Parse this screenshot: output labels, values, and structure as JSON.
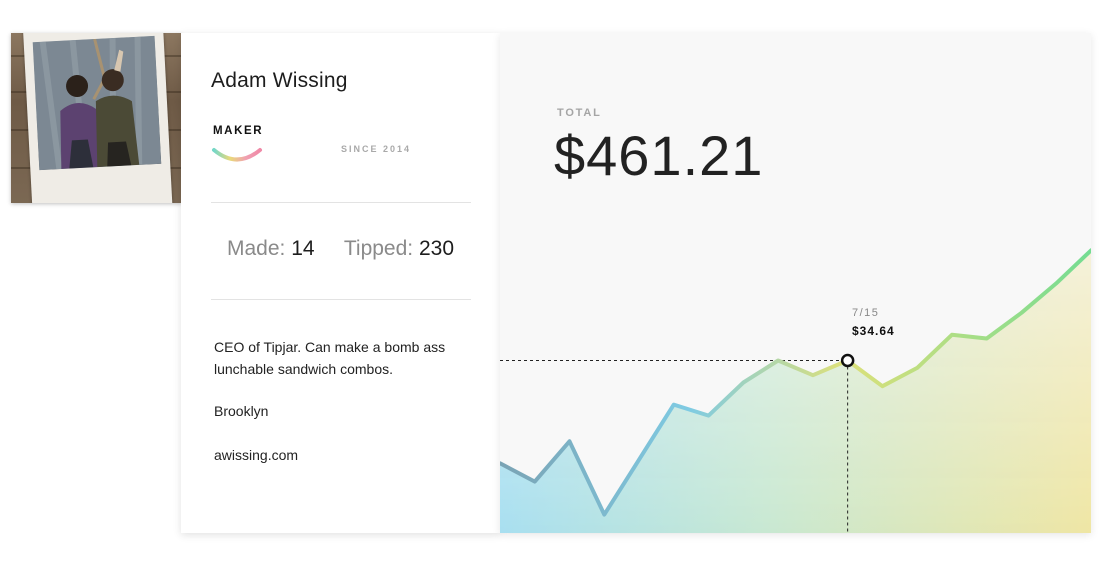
{
  "profile": {
    "name": "Adam Wissing",
    "badge": "MAKER",
    "since": "SINCE 2014",
    "stats": {
      "made_label": "Made:",
      "made_value": "14",
      "tipped_label": "Tipped:",
      "tipped_value": "230"
    },
    "bio": "CEO of Tipjar. Can make a bomb ass lunchable sandwich combos.",
    "location": "Brooklyn",
    "website": "awissing.com"
  },
  "summary": {
    "total_label": "TOTAL",
    "total_value": "$461.21"
  },
  "tooltip": {
    "date": "7/15",
    "value": "$34.64"
  },
  "colors": {
    "line_start": "#7aa3b4",
    "line_mid": "#7fcbe3",
    "line_peak": "#dde07a",
    "line_end": "#74dc92",
    "area_bottom_left": "#a8dff0",
    "area_bottom_right": "#efe6a4"
  },
  "icons": {
    "maker_badge": "smile-gradient-icon"
  },
  "chart_data": {
    "type": "area",
    "highlight_index": 10,
    "series": [
      {
        "values": [
          0.19,
          0.14,
          0.25,
          0.05,
          0.2,
          0.35,
          0.32,
          0.41,
          0.47,
          0.43,
          0.47,
          0.4,
          0.45,
          0.54,
          0.53,
          0.6,
          0.68,
          0.77
        ]
      }
    ]
  }
}
